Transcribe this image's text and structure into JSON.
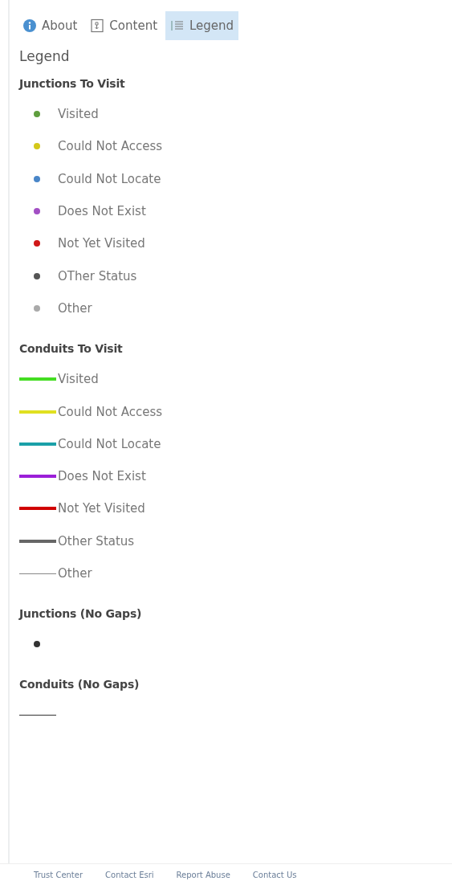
{
  "tabs": [
    {
      "label": "About",
      "kind": "info",
      "selected": false
    },
    {
      "label": "Content",
      "kind": "content",
      "selected": false
    },
    {
      "label": "Legend",
      "kind": "legend",
      "selected": true
    }
  ],
  "panel_title": "Legend",
  "sections": [
    {
      "heading": "Junctions To Visit",
      "items": [
        {
          "kind": "dot",
          "color": "#5f9e3e",
          "label": "Visited"
        },
        {
          "kind": "dot",
          "color": "#d4c81a",
          "label": "Could Not Access"
        },
        {
          "kind": "dot",
          "color": "#4a86c8",
          "label": "Could Not Locate"
        },
        {
          "kind": "dot",
          "color": "#a24fc4",
          "label": "Does Not Exist"
        },
        {
          "kind": "dot",
          "color": "#d01818",
          "label": "Not Yet Visited"
        },
        {
          "kind": "dot",
          "color": "#555555",
          "label": "OTher Status"
        },
        {
          "kind": "dot",
          "color": "#aaaaaa",
          "label": "Other"
        }
      ]
    },
    {
      "heading": "Conduits To Visit",
      "items": [
        {
          "kind": "bar",
          "color": "#44dd22",
          "label": "Visited"
        },
        {
          "kind": "bar",
          "color": "#e0e020",
          "label": "Could Not Access"
        },
        {
          "kind": "bar",
          "color": "#1aa0a8",
          "label": "Could Not Locate"
        },
        {
          "kind": "bar",
          "color": "#9b1fd8",
          "label": "Does Not Exist"
        },
        {
          "kind": "bar",
          "color": "#d00000",
          "label": "Not Yet Visited"
        },
        {
          "kind": "bar",
          "color": "#666666",
          "label": "Other Status"
        },
        {
          "kind": "line",
          "color": "#888888",
          "label": "Other"
        }
      ]
    },
    {
      "heading": "Junctions (No Gaps)",
      "items": [
        {
          "kind": "dot",
          "color": "#333333"
        }
      ]
    },
    {
      "heading": "Conduits (No Gaps)",
      "items": [
        {
          "kind": "line",
          "color": "#333333"
        }
      ]
    }
  ],
  "footer_links": [
    "Trust Center",
    "Contact Esri",
    "Report Abuse",
    "Contact Us"
  ]
}
